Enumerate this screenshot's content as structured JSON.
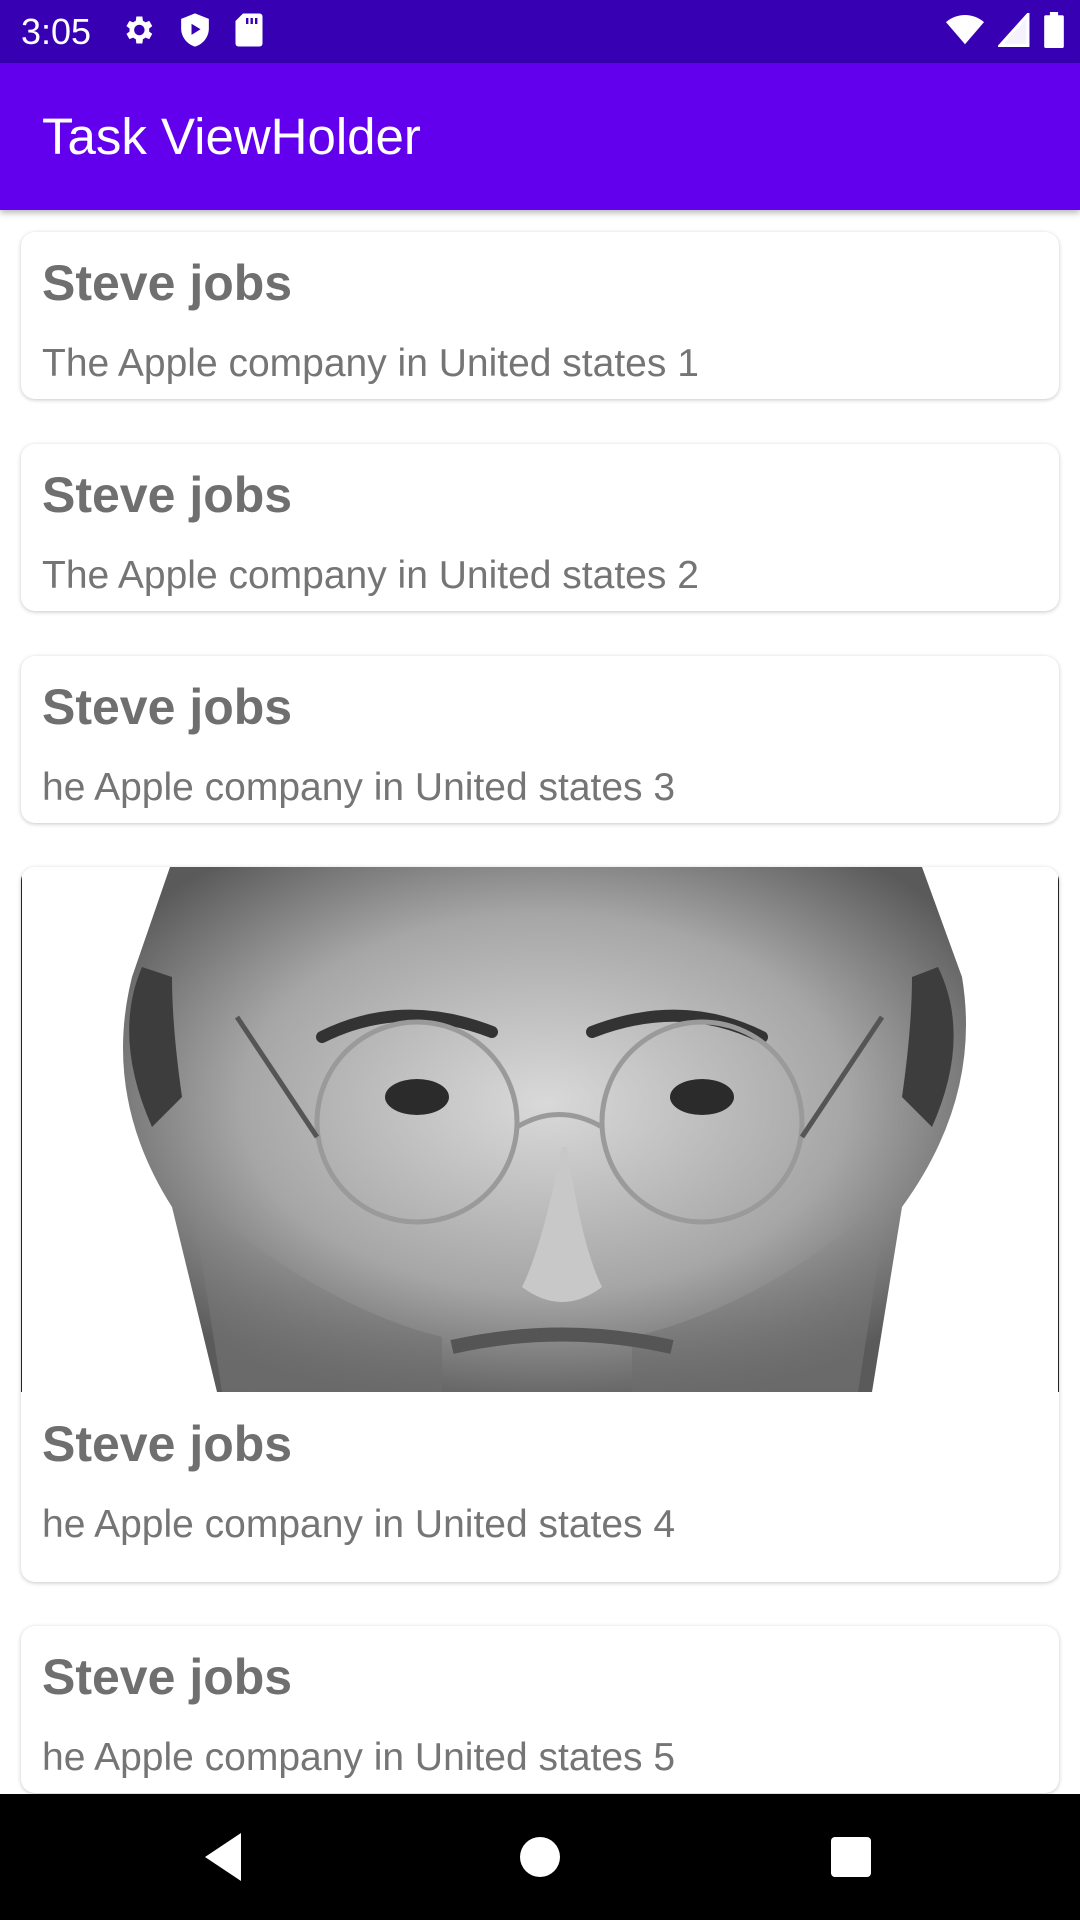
{
  "status_bar": {
    "time": "3:05",
    "left_icons": [
      "settings-icon",
      "play-protect-icon",
      "sd-card-icon"
    ],
    "right_icons": [
      "wifi-icon",
      "cell-signal-icon",
      "battery-icon"
    ]
  },
  "app_bar": {
    "title": "Task ViewHolder",
    "color": "#6200ee"
  },
  "cards": [
    {
      "title": "Steve jobs",
      "description": "The Apple company in United states 1",
      "has_image": false
    },
    {
      "title": "Steve jobs",
      "description": "The Apple company in United states 2",
      "has_image": false
    },
    {
      "title": "Steve jobs",
      "description": "he Apple company in United states 3",
      "has_image": false
    },
    {
      "title": "Steve jobs",
      "description": "he Apple company in United states 4",
      "has_image": true,
      "image": "portrait-photo"
    },
    {
      "title": "Steve jobs",
      "description": "he Apple company in United states 5",
      "has_image": false
    }
  ],
  "nav_bar": {
    "buttons": [
      "back-icon",
      "home-icon",
      "recents-icon"
    ]
  },
  "colors": {
    "status_bar": "#3700b3",
    "app_bar": "#6200ee",
    "text_title": "#6f6f6f",
    "text_body": "#757575"
  }
}
